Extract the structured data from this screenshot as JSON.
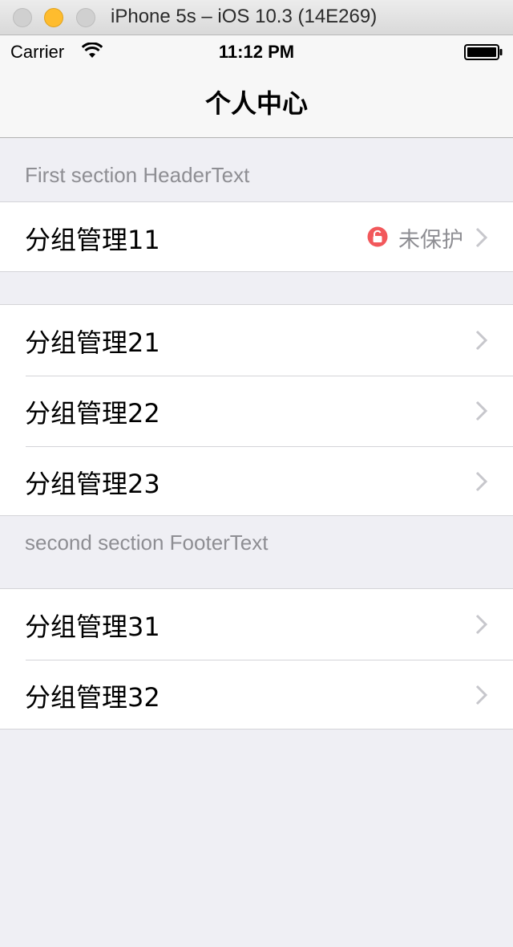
{
  "window": {
    "title": "iPhone 5s – iOS 10.3 (14E269)"
  },
  "status_bar": {
    "carrier": "Carrier",
    "time": "11:12 PM"
  },
  "nav": {
    "title": "个人中心"
  },
  "sections": [
    {
      "header": "First section HeaderText",
      "rows": [
        {
          "label": "分组管理11",
          "detail": "未保护",
          "icon": "lock-icon"
        }
      ]
    },
    {
      "footer": "second section FooterText",
      "rows": [
        {
          "label": "分组管理21"
        },
        {
          "label": "分组管理22"
        },
        {
          "label": "分组管理23"
        }
      ]
    },
    {
      "rows": [
        {
          "label": "分组管理31"
        },
        {
          "label": "分组管理32"
        }
      ]
    }
  ],
  "colors": {
    "accent_lock": "#f2585b",
    "background": "#efeff4",
    "secondary_text": "#8e8e93"
  }
}
